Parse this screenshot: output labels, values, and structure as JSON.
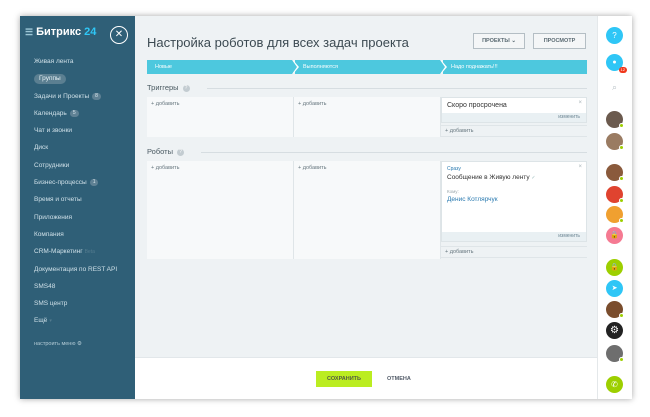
{
  "sidebar": {
    "logo_main": "Битрикс",
    "logo_num": "24",
    "menu_icon": "hamburger-menu-icon",
    "close_icon": "close-icon",
    "items": [
      {
        "label": "Живая лента"
      },
      {
        "label": "Группы",
        "active": true
      },
      {
        "label": "Задачи и Проекты",
        "badge": "8"
      },
      {
        "label": "Календарь",
        "badge": "5"
      },
      {
        "label": "Чат и звонки"
      },
      {
        "label": "Диск"
      },
      {
        "label": "Сотрудники"
      },
      {
        "label": "Бизнес-процессы",
        "badge": "1"
      },
      {
        "label": "Время и отчеты"
      },
      {
        "label": "Приложения"
      },
      {
        "label": "Компания"
      },
      {
        "label": "CRM-Маркетинг",
        "note": "Beta"
      },
      {
        "label": "Документация по REST API"
      },
      {
        "label": "SMS48"
      },
      {
        "label": "SMS центр"
      },
      {
        "label": "Ещё"
      }
    ],
    "setup_label": "настроить меню"
  },
  "header": {
    "title": "Настройка роботов для всех задач проекта",
    "projects_button": "ПРОЕКТЫ",
    "view_button": "ПРОСМОТР"
  },
  "stages": [
    "Новые",
    "Выполняются",
    "Надо поднажать!!!"
  ],
  "triggers": {
    "label": "Триггеры",
    "add_label": "+ добавить",
    "card": {
      "text": "Скоро просрочена",
      "edit": "изменить"
    }
  },
  "robots": {
    "label": "Роботы",
    "add_label": "+ добавить",
    "card": {
      "tag": "Сразу",
      "action": "Сообщение в Живую ленту",
      "who_label": "Кому:",
      "who": "Денис Котлярчук",
      "edit": "изменить"
    }
  },
  "footer": {
    "save": "СОХРАНИТЬ",
    "cancel": "ОТМЕНА"
  },
  "rightbar": {
    "notifications_count": "12"
  },
  "colors": {
    "sidebar_bg": "#2f5f77",
    "stage_bg": "#4dc8de",
    "save_bg": "#bbed21",
    "online_dot": "#9dcf00"
  }
}
